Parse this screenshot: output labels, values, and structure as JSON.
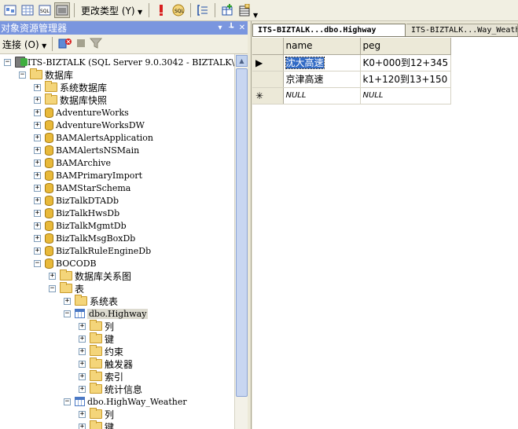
{
  "toolbar": {
    "change_type_label": "更改类型 (Y)",
    "icons": [
      "show-diagram-pane-icon",
      "show-grid-pane-icon",
      "show-sql-pane-icon",
      "show-results-pane-icon",
      "execute-sql-icon",
      "verify-sql-icon",
      "add-group-by-icon",
      "add-table-icon",
      "add-derived-table-icon"
    ]
  },
  "object_explorer": {
    "title": "对象资源管理器",
    "connect_label": "连接 (O)",
    "nodes": [
      {
        "label": "ITS-BIZTALK (SQL Server 9.0.3042 - BIZTALK\\",
        "icon": "server",
        "expanded": true
      },
      {
        "label": "数据库",
        "icon": "folder",
        "expanded": true
      },
      {
        "label": "系统数据库",
        "icon": "folder",
        "expanded": false
      },
      {
        "label": "数据库快照",
        "icon": "folder",
        "expanded": false
      },
      {
        "label": "AdventureWorks",
        "icon": "database",
        "expanded": false
      },
      {
        "label": "AdventureWorksDW",
        "icon": "database",
        "expanded": false
      },
      {
        "label": "BAMAlertsApplication",
        "icon": "database",
        "expanded": false
      },
      {
        "label": "BAMAlertsNSMain",
        "icon": "database",
        "expanded": false
      },
      {
        "label": "BAMArchive",
        "icon": "database",
        "expanded": false
      },
      {
        "label": "BAMPrimaryImport",
        "icon": "database",
        "expanded": false
      },
      {
        "label": "BAMStarSchema",
        "icon": "database",
        "expanded": false
      },
      {
        "label": "BizTalkDTADb",
        "icon": "database",
        "expanded": false
      },
      {
        "label": "BizTalkHwsDb",
        "icon": "database",
        "expanded": false
      },
      {
        "label": "BizTalkMgmtDb",
        "icon": "database",
        "expanded": false
      },
      {
        "label": "BizTalkMsgBoxDb",
        "icon": "database",
        "expanded": false
      },
      {
        "label": "BizTalkRuleEngineDb",
        "icon": "database",
        "expanded": false
      },
      {
        "label": "BOCODB",
        "icon": "database",
        "expanded": true
      },
      {
        "label": "数据库关系图",
        "icon": "folder",
        "expanded": false
      },
      {
        "label": "表",
        "icon": "folder",
        "expanded": true
      },
      {
        "label": "系统表",
        "icon": "folder",
        "expanded": false
      },
      {
        "label": "dbo.Highway",
        "icon": "table",
        "expanded": true,
        "selected": true
      },
      {
        "label": "列",
        "icon": "folder",
        "expanded": false
      },
      {
        "label": "键",
        "icon": "folder",
        "expanded": false
      },
      {
        "label": "约束",
        "icon": "folder",
        "expanded": false
      },
      {
        "label": "触发器",
        "icon": "folder",
        "expanded": false
      },
      {
        "label": "索引",
        "icon": "folder",
        "expanded": false
      },
      {
        "label": "统计信息",
        "icon": "folder",
        "expanded": false
      },
      {
        "label": "dbo.HighWay_Weather",
        "icon": "table",
        "expanded": true
      },
      {
        "label": "列",
        "icon": "folder",
        "expanded": false
      },
      {
        "label": "键",
        "icon": "folder",
        "expanded": false
      }
    ]
  },
  "tabs": [
    {
      "label": "ITS-BIZTALK...dbo.Highway",
      "active": true
    },
    {
      "label": "ITS-BIZTALK...Way_Weather",
      "active": false
    }
  ],
  "grid": {
    "columns": [
      "name",
      "peg"
    ],
    "rows": [
      {
        "marker": "▶",
        "name": "沈大高速",
        "peg": "K0+000到12+345"
      },
      {
        "marker": "",
        "name": "京津高速",
        "peg": "k1+120到13+150"
      },
      {
        "marker": "✳",
        "name": "NULL",
        "peg": "NULL"
      }
    ]
  }
}
